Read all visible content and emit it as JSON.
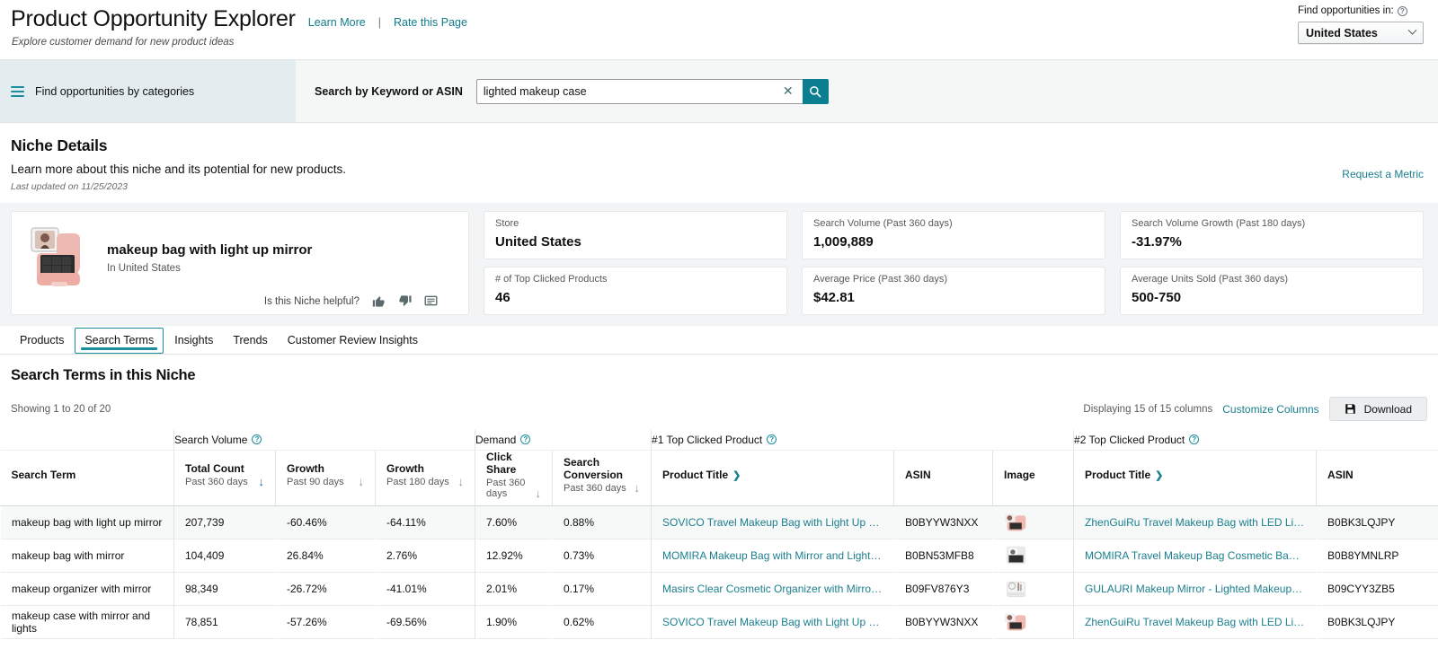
{
  "header": {
    "app_title": "Product Opportunity Explorer",
    "learn_more": "Learn More",
    "separator": "|",
    "rate_page": "Rate this Page",
    "subtitle": "Explore customer demand for new product ideas",
    "locale_label": "Find opportunities in:",
    "locale_value": "United States"
  },
  "searchband": {
    "categories_label": "Find opportunities by categories",
    "search_label": "Search by Keyword or ASIN",
    "search_value": "lighted makeup case",
    "search_placeholder": "Search by Keyword or ASIN"
  },
  "niche": {
    "heading": "Niche Details",
    "description": "Learn more about this niche and its potential for new products.",
    "last_updated": "Last updated on 11/25/2023",
    "request_metric": "Request a Metric",
    "name": "makeup bag with light up mirror",
    "location": "In United States",
    "helpful_label": "Is this Niche helpful?"
  },
  "metrics": [
    {
      "label": "Store",
      "value": "United States"
    },
    {
      "label": "Search Volume (Past 360 days)",
      "value": "1,009,889"
    },
    {
      "label": "Search Volume Growth (Past 180 days)",
      "value": "-31.97%"
    },
    {
      "label": "# of Top Clicked Products",
      "value": "46"
    },
    {
      "label": "Average Price (Past 360 days)",
      "value": "$42.81"
    },
    {
      "label": "Average Units Sold (Past 360 days)",
      "value": "500-750"
    }
  ],
  "tabs": [
    {
      "label": "Products",
      "active": false
    },
    {
      "label": "Search Terms",
      "active": true
    },
    {
      "label": "Insights",
      "active": false
    },
    {
      "label": "Trends",
      "active": false
    },
    {
      "label": "Customer Review Insights",
      "active": false
    }
  ],
  "table_section": {
    "title": "Search Terms in this Niche",
    "showing": "Showing 1 to 20 of 20",
    "displaying_columns": "Displaying 15 of 15 columns",
    "customize_columns": "Customize Columns",
    "download": "Download"
  },
  "table": {
    "groups": {
      "search_volume": "Search Volume",
      "demand": "Demand",
      "top1": "#1 Top Clicked Product",
      "top2": "#2 Top Clicked Product"
    },
    "columns": {
      "search_term": "Search Term",
      "total_count": "Total Count",
      "total_count_sub": "Past 360 days",
      "growth90": "Growth",
      "growth90_sub": "Past 90 days",
      "growth180": "Growth",
      "growth180_sub": "Past 180 days",
      "click_share": "Click Share",
      "click_share_sub": "Past 360 days",
      "search_conversion": "Search",
      "search_conversion2": "Conversion",
      "search_conversion_sub": "Past 360 days",
      "product_title": "Product Title",
      "asin": "ASIN",
      "image": "Image"
    },
    "rows": [
      {
        "term": "makeup bag with light up mirror",
        "total_count": "207,739",
        "growth90": "-60.46%",
        "growth180": "-64.11%",
        "click_share": "7.60%",
        "search_conversion": "0.88%",
        "p1_title": "SOVICO Travel Makeup Bag with Light Up Mirror …",
        "p1_asin": "B0BYYW3NXX",
        "p2_title": "ZhenGuiRu Travel Makeup Bag with LED Lighted …",
        "p2_asin": "B0BK3LQJPY"
      },
      {
        "term": "makeup bag with mirror",
        "total_count": "104,409",
        "growth90": "26.84%",
        "growth180": "2.76%",
        "click_share": "12.92%",
        "search_conversion": "0.73%",
        "p1_title": "MOMIRA Makeup Bag with Mirror and Light Travel…",
        "p1_asin": "B0BN53MFB8",
        "p2_title": "MOMIRA Travel Makeup Bag Cosmetic Bag Make…",
        "p2_asin": "B0B8YMNLRP"
      },
      {
        "term": "makeup organizer with mirror",
        "total_count": "98,349",
        "growth90": "-26.72%",
        "growth180": "-41.01%",
        "click_share": "2.01%",
        "search_conversion": "0.17%",
        "p1_title": "Masirs Clear Cosmetic Organizer with Mirror Easil…",
        "p1_asin": "B09FV876Y3",
        "p2_title": "GULAURI Makeup Mirror - Lighted Makeup Mirror …",
        "p2_asin": "B09CYY3ZB5"
      },
      {
        "term": "makeup case with mirror and lights",
        "total_count": "78,851",
        "growth90": "-57.26%",
        "growth180": "-69.56%",
        "click_share": "1.90%",
        "search_conversion": "0.62%",
        "p1_title": "SOVICO Travel Makeup Bag with Light Up Mirror …",
        "p1_asin": "B0BYYW3NXX",
        "p2_title": "ZhenGuiRu Travel Makeup Bag with LED Lighted …",
        "p2_asin": "B0BK3LQJPY"
      }
    ]
  },
  "colors": {
    "teal": "#1a8d9e",
    "link": "#1a7f8e",
    "search_button": "#0b7f8f",
    "band": "#e3ecee",
    "card_bg": "#f2f4f5"
  }
}
